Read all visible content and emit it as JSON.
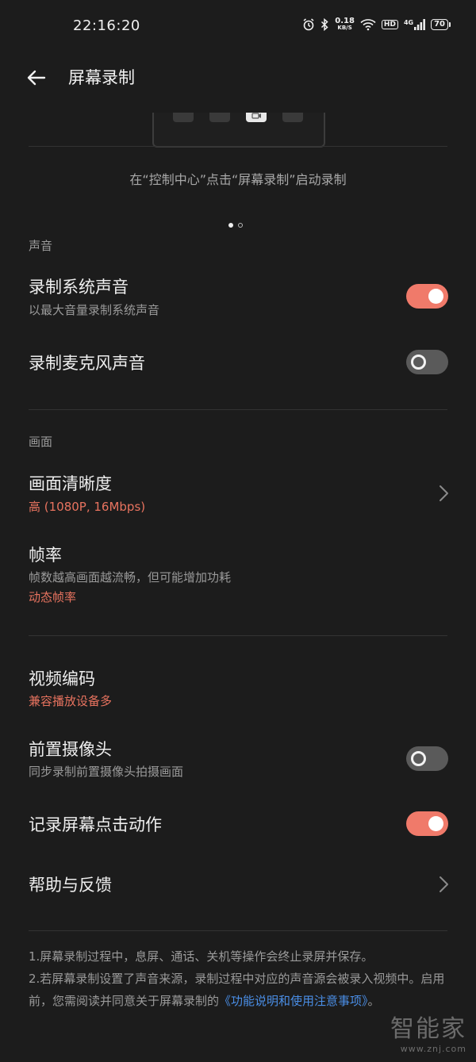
{
  "status_bar": {
    "time": "22:16:20",
    "net_speed_value": "0.18",
    "net_speed_unit": "KB/S",
    "hd_label": "HD",
    "signal_label": "4G",
    "battery": "70"
  },
  "header": {
    "title": "屏幕录制"
  },
  "intro": {
    "hint": "在“控制中心”点击“屏幕录制”启动录制",
    "page_count": 2,
    "current_page": 1
  },
  "sound_section": {
    "label": "声音",
    "system_sound": {
      "title": "录制系统声音",
      "subtitle": "以最大音量录制系统声音",
      "enabled": true
    },
    "mic_sound": {
      "title": "录制麦克风声音",
      "enabled": false
    }
  },
  "picture_section": {
    "label": "画面",
    "clarity": {
      "title": "画面清晰度",
      "value": "高 (1080P, 16Mbps)"
    },
    "frame_rate": {
      "title": "帧率",
      "subtitle": "帧数越高画面越流畅，但可能增加功耗",
      "value": "动态帧率"
    }
  },
  "other_section": {
    "video_codec": {
      "title": "视频编码",
      "value": "兼容播放设备多"
    },
    "front_camera": {
      "title": "前置摄像头",
      "subtitle": "同步录制前置摄像头拍摄画面",
      "enabled": false
    },
    "tap_record": {
      "title": "记录屏幕点击动作",
      "enabled": true
    },
    "help": {
      "title": "帮助与反馈"
    }
  },
  "notes": {
    "line1": "1.屏幕录制过程中，息屏、通话、关机等操作会终止录屏并保存。",
    "line2_prefix": "2.若屏幕录制设置了声音来源，录制过程中对应的声音源会被录入视频中。启用前，您需阅读并同意关于屏幕录制的",
    "link_text": "《功能说明和使用注意事项》",
    "line2_suffix": "。"
  },
  "watermark": {
    "brand": "智能家",
    "url": "www.znj.com"
  },
  "colors": {
    "accent": "#e8735f",
    "toggle_on": "#f07a6a",
    "toggle_off": "#5a5a5a",
    "link": "#4a8ee6",
    "background": "#1c1c1c"
  }
}
